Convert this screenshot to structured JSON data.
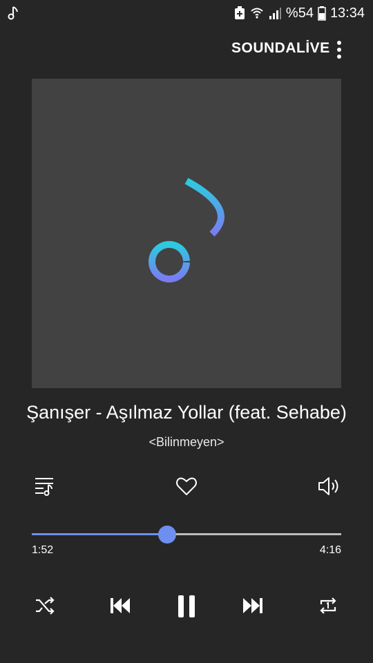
{
  "status_bar": {
    "battery": "%54",
    "time": "13:34"
  },
  "toolbar": {
    "brand": "SOUNDALİVE"
  },
  "track": {
    "title": "Şanışer - Aşılmaz Yollar (feat. Sehabe)",
    "artist": "<Bilinmeyen>",
    "current_time": "1:52",
    "duration": "4:16",
    "progress": 0.4375
  },
  "colors": {
    "background": "#262626",
    "album_bg": "#424242",
    "accent": "#6e8ff0",
    "note_gradient_top": "#2ccbe0",
    "note_gradient_bottom": "#7a7cf2"
  },
  "icons": {
    "status_left": "music-note-icon",
    "controls": [
      "shuffle-icon",
      "previous-icon",
      "pause-icon",
      "next-icon",
      "repeat-one-icon"
    ],
    "actions": [
      "playlist-icon",
      "heart-icon",
      "volume-icon"
    ]
  }
}
